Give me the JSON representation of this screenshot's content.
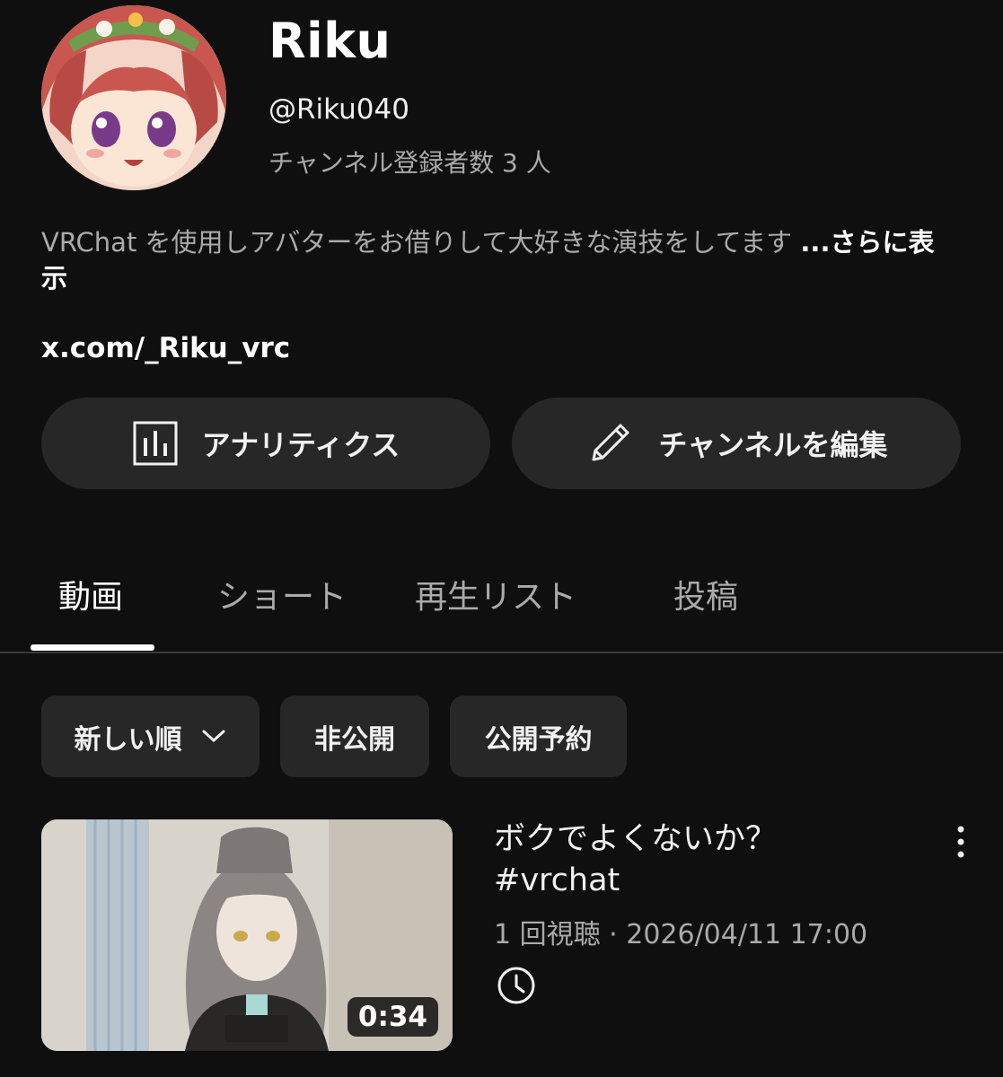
{
  "channel": {
    "name": "Riku",
    "handle": "@Riku040",
    "subscribers": "チャンネル登録者数 3 人",
    "description": "VRChat を使用しアバターをお借りして大好きな演技をしてます ",
    "more_label": "...さらに表示",
    "link": "x.com/_Riku_vrc"
  },
  "actions": {
    "analytics_label": "アナリティクス",
    "edit_label": "チャンネルを編集"
  },
  "tabs": {
    "videos": "動画",
    "shorts": "ショート",
    "playlists": "再生リスト",
    "posts": "投稿",
    "active": "videos"
  },
  "filters": {
    "sort_label": "新しい順",
    "private_label": "非公開",
    "scheduled_label": "公開予約"
  },
  "video": {
    "title": "ボクでよくないか？ #vrchat",
    "meta": "1 回視聴 · 2026/04/11 17:00",
    "duration": "0:34",
    "status_icon": "clock-icon"
  },
  "colors": {
    "background": "#0f0f0f",
    "surface": "#272727",
    "text_primary": "#f1f1f1",
    "text_secondary": "#aaaaaa"
  }
}
